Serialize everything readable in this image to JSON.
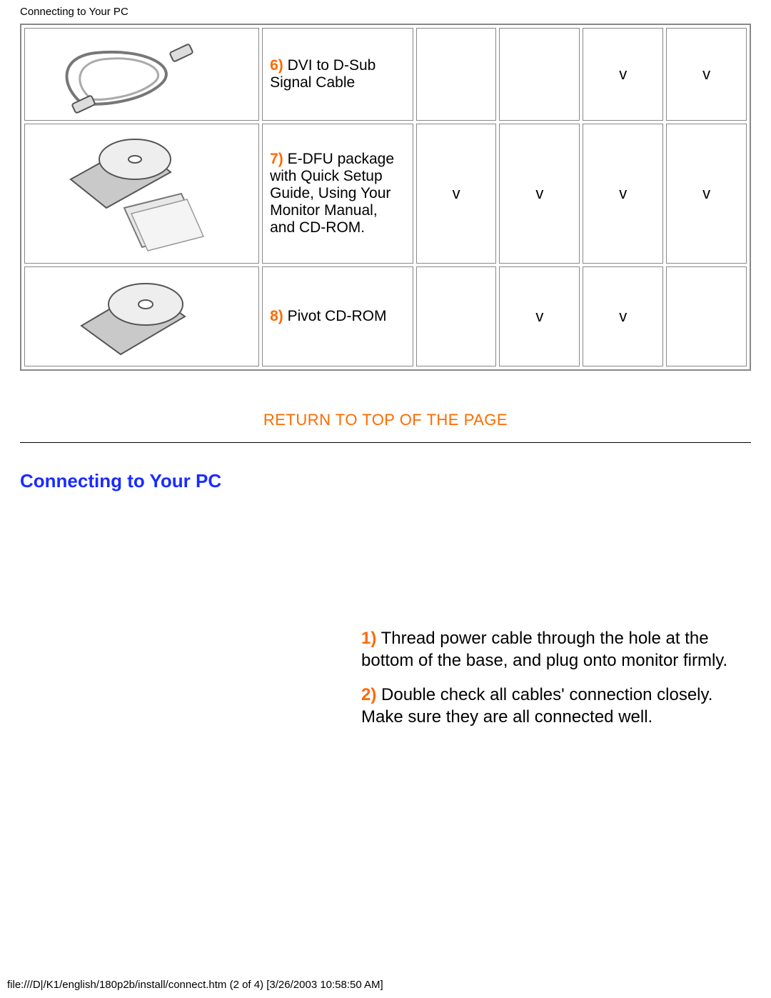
{
  "header": {
    "title": "Connecting to Your PC"
  },
  "table": {
    "rows": [
      {
        "num": "6)",
        "text": " DVI to D-Sub Signal Cable",
        "checks": [
          "",
          "",
          "v",
          "v"
        ]
      },
      {
        "num": "7)",
        "text": " E-DFU package with Quick Setup Guide, Using Your Monitor Manual, and CD-ROM.",
        "checks": [
          "v",
          "v",
          "v",
          "v"
        ]
      },
      {
        "num": "8)",
        "text": " Pivot CD-ROM",
        "checks": [
          "",
          "v",
          "v",
          ""
        ]
      }
    ]
  },
  "topLink": "RETURN TO TOP OF THE PAGE",
  "sectionHeading": "Connecting to Your PC",
  "steps": [
    {
      "num": "1)",
      "text": " Thread power cable through the hole at the bottom of the base, and plug onto monitor firmly."
    },
    {
      "num": "2)",
      "text": " Double check all cables' connection closely. Make sure they are all connected well."
    }
  ],
  "footer": "file:///D|/K1/english/180p2b/install/connect.htm (2 of 4) [3/26/2003 10:58:50 AM]"
}
